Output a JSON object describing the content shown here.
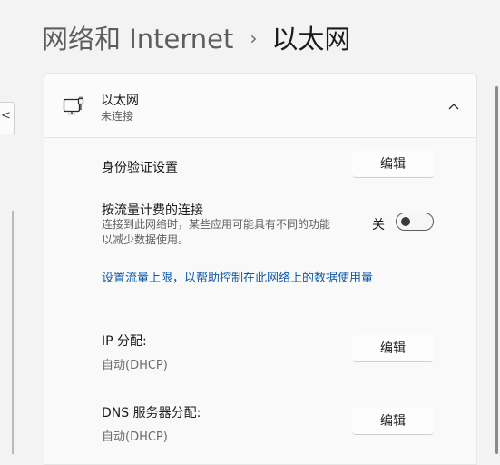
{
  "breadcrumb": {
    "parent": "网络和 Internet",
    "separator": "›",
    "current": "以太网"
  },
  "left_panel": {
    "glyph": "<"
  },
  "adapter": {
    "name": "以太网",
    "status": "未连接"
  },
  "settings": {
    "authentication": {
      "label": "身份验证设置",
      "button": "编辑"
    },
    "metered": {
      "label": "按流量计费的连接",
      "description_line1": "连接到此网络时，某些应用可能具有不同的功能",
      "description_line2": "以减少数据使用。",
      "state": "关",
      "enabled": false
    },
    "data_limit_link": "设置流量上限，以帮助控制在此网络上的数据使用量",
    "ip_assignment": {
      "label": "IP 分配:",
      "value": "自动(DHCP)",
      "button": "编辑"
    },
    "dns_assignment": {
      "label": "DNS 服务器分配:",
      "value": "自动(DHCP)",
      "button": "编辑"
    }
  },
  "icons": {
    "adapter": "ethernet-icon",
    "collapse": "chevron-up-icon",
    "breadcrumb_separator": "chevron-right-icon"
  },
  "colors": {
    "accent_link": "#0f5aa8",
    "background": "#f3f3f3",
    "card": "#fbfbfb"
  }
}
